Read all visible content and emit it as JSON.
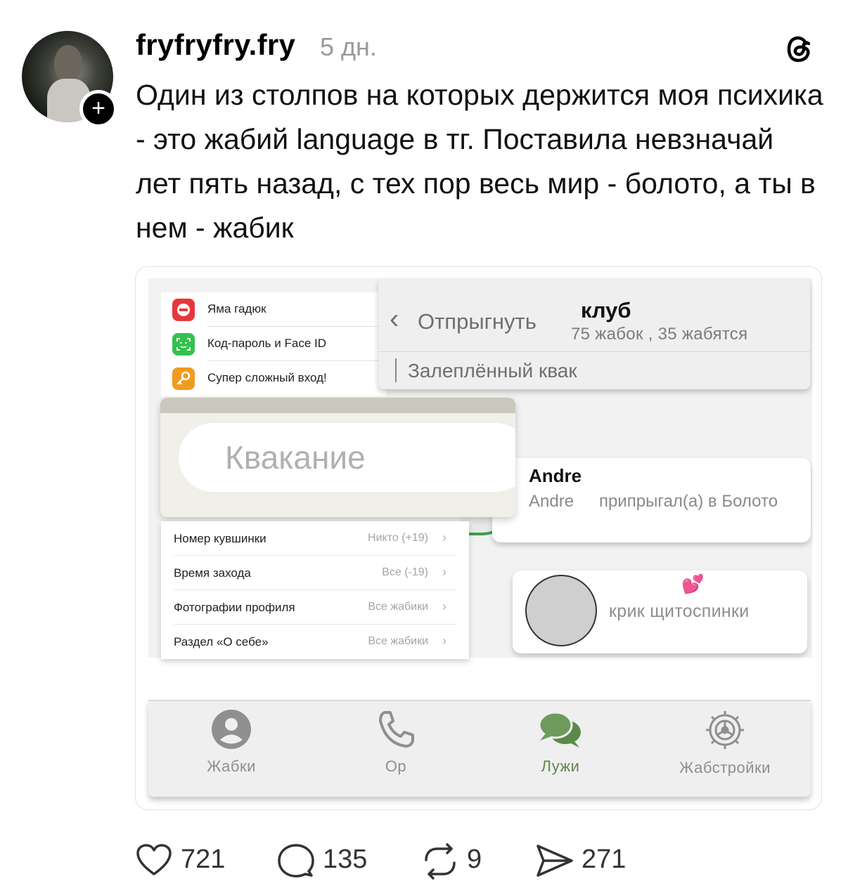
{
  "post": {
    "username": "fryfryfry.fry",
    "time": "5 дн.",
    "follow_label": "+",
    "text": "Один из столпов на которых держится моя психика - это жабий language в тг. Поставила невзначай лет пять назад, с тех пор весь мир - болото, а ты в нем - жабик"
  },
  "image": {
    "privacy_items": [
      {
        "label": "Яма гадюк",
        "icon": "minus-circle-icon",
        "color": "#e5383b"
      },
      {
        "label": "Код-пароль и Face ID",
        "icon": "face-id-icon",
        "color": "#33c24d"
      },
      {
        "label": "Супер сложный вход!",
        "icon": "key-icon",
        "color": "#f19a1f"
      }
    ],
    "chat_header": {
      "back_label": "Отпрыгнуть",
      "title": "клуб",
      "subtitle": "75 жабок , 35 жабятся",
      "pinned": "Залеплённый квак"
    },
    "search": {
      "placeholder": "Квакание"
    },
    "andre_message": {
      "name": "Andre",
      "user": "Andre",
      "text": "припрыгал(а) в Болото"
    },
    "settings_items": [
      {
        "label": "Номер кувшинки",
        "value": "Никто (+19)"
      },
      {
        "label": "Время захода",
        "value": "Все (-19)"
      },
      {
        "label": "Фотографии профиля",
        "value": "Все жабики"
      },
      {
        "label": "Раздел «О себе»",
        "value": "Все жабики"
      }
    ],
    "scream": {
      "hearts": "💕",
      "label": "крик щитоспинки"
    },
    "tabs": [
      {
        "label": "Жабки",
        "icon": "person-circle-icon",
        "active": false
      },
      {
        "label": "Ор",
        "icon": "phone-icon",
        "active": false
      },
      {
        "label": "Лужи",
        "icon": "chat-bubbles-icon",
        "active": true
      },
      {
        "label": "Жабстройки",
        "icon": "gear-icon",
        "active": false
      }
    ]
  },
  "actions": {
    "likes": "721",
    "comments": "135",
    "reposts": "9",
    "shares": "271"
  },
  "colors": {
    "accent_green": "#5a8a4a",
    "online_green": "#3aa04a",
    "text_muted": "#9a9a9a"
  }
}
